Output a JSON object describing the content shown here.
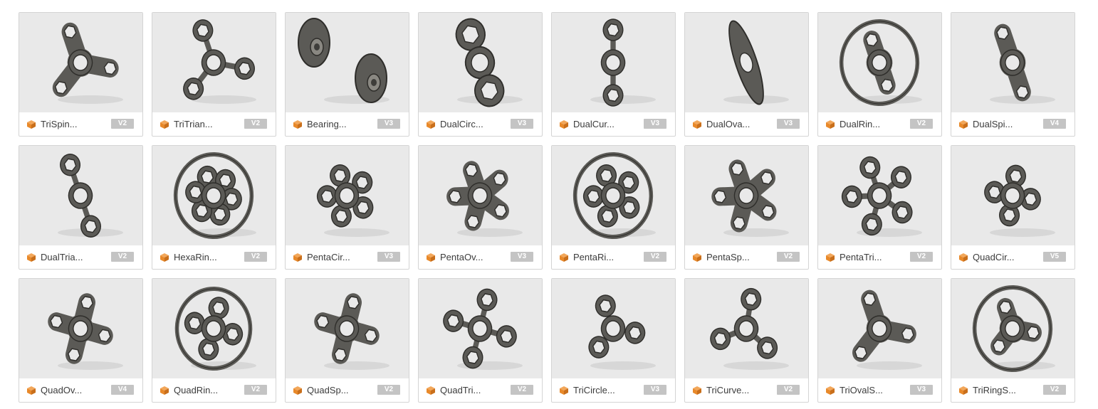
{
  "design_icon": "orange-design-cube-icon",
  "colors": {
    "model": "#5b5a56",
    "model_dark": "#2e2d2a",
    "thumb_bg": "#e9e9e9",
    "badge_bg": "#c4c4c4",
    "accent": "#e8892a"
  },
  "items": [
    {
      "name": "TriSpin...",
      "version": "V2",
      "shape": "tri-spinner"
    },
    {
      "name": "TriTrian...",
      "version": "V2",
      "shape": "tri-triangle"
    },
    {
      "name": "Bearing...",
      "version": "V3",
      "shape": "bearing"
    },
    {
      "name": "DualCirc...",
      "version": "V3",
      "shape": "dual-circle"
    },
    {
      "name": "DualCur...",
      "version": "V3",
      "shape": "dual-curve"
    },
    {
      "name": "DualOva...",
      "version": "V3",
      "shape": "dual-oval"
    },
    {
      "name": "DualRin...",
      "version": "V2",
      "shape": "dual-ring"
    },
    {
      "name": "DualSpi...",
      "version": "V4",
      "shape": "dual-spinner"
    },
    {
      "name": "DualTria...",
      "version": "V2",
      "shape": "dual-triangle"
    },
    {
      "name": "HexaRin...",
      "version": "V2",
      "shape": "hexa-ring"
    },
    {
      "name": "PentaCir...",
      "version": "V3",
      "shape": "penta-circle"
    },
    {
      "name": "PentaOv...",
      "version": "V3",
      "shape": "penta-oval"
    },
    {
      "name": "PentaRi...",
      "version": "V2",
      "shape": "penta-ring"
    },
    {
      "name": "PentaSp...",
      "version": "V2",
      "shape": "penta-spinner"
    },
    {
      "name": "PentaTri...",
      "version": "V2",
      "shape": "penta-triangle"
    },
    {
      "name": "QuadCir...",
      "version": "V5",
      "shape": "quad-circle"
    },
    {
      "name": "QuadOv...",
      "version": "V4",
      "shape": "quad-oval"
    },
    {
      "name": "QuadRin...",
      "version": "V2",
      "shape": "quad-ring"
    },
    {
      "name": "QuadSp...",
      "version": "V2",
      "shape": "quad-spinner"
    },
    {
      "name": "QuadTri...",
      "version": "V2",
      "shape": "quad-triangle"
    },
    {
      "name": "TriCircle...",
      "version": "V3",
      "shape": "tri-circle"
    },
    {
      "name": "TriCurve...",
      "version": "V2",
      "shape": "tri-curve"
    },
    {
      "name": "TriOvalS...",
      "version": "V3",
      "shape": "tri-oval"
    },
    {
      "name": "TriRingS...",
      "version": "V2",
      "shape": "tri-ring"
    }
  ]
}
